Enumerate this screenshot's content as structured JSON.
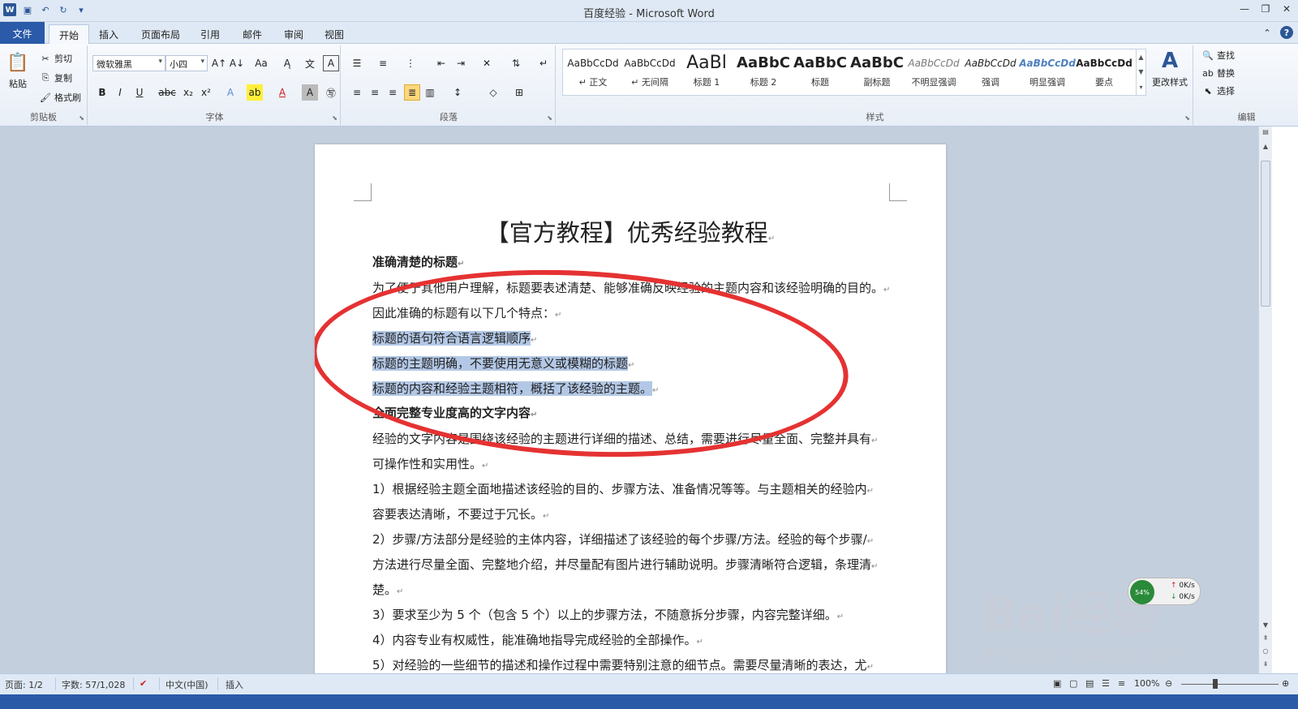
{
  "window": {
    "title": "百度经验 - Microsoft Word"
  },
  "qat": {
    "app_icon": "W"
  },
  "tabs": [
    "文件",
    "开始",
    "插入",
    "页面布局",
    "引用",
    "邮件",
    "审阅",
    "视图"
  ],
  "ribbon": {
    "clipboard": {
      "label": "剪贴板",
      "paste": "粘贴",
      "cut": "剪切",
      "copy": "复制",
      "format_painter": "格式刷"
    },
    "font": {
      "label": "字体",
      "font_name": "微软雅黑",
      "font_size": "小四"
    },
    "paragraph": {
      "label": "段落"
    },
    "styles": {
      "label": "样式",
      "items": [
        {
          "sample": "AaBbCcDd",
          "name": "↵ 正文"
        },
        {
          "sample": "AaBbCcDd",
          "name": "↵ 无间隔"
        },
        {
          "sample": "AaBl",
          "name": "标题 1"
        },
        {
          "sample": "AaBbC",
          "name": "标题 2"
        },
        {
          "sample": "AaBbC",
          "name": "标题"
        },
        {
          "sample": "AaBbC",
          "name": "副标题"
        },
        {
          "sample": "AaBbCcDd",
          "name": "不明显强调"
        },
        {
          "sample": "AaBbCcDd",
          "name": "强调"
        },
        {
          "sample": "AaBbCcDd",
          "name": "明显强调"
        },
        {
          "sample": "AaBbCcDd",
          "name": "要点"
        }
      ],
      "change_styles": "更改样式"
    },
    "editing": {
      "label": "编辑",
      "find": "查找",
      "replace": "替换",
      "select": "选择"
    }
  },
  "document": {
    "title": "【官方教程】优秀经验教程",
    "lines": [
      {
        "text": "准确清楚的标题",
        "bold": true
      },
      {
        "text": "为了便于其他用户理解，标题要表述清楚、能够准确反映经验的主题内容和该经验明确的目的。"
      },
      {
        "text": "因此准确的标题有以下几个特点："
      },
      {
        "text": "标题的语句符合语言逻辑顺序",
        "selected": true
      },
      {
        "text": "标题的主题明确，不要使用无意义或模糊的标题",
        "selected": true
      },
      {
        "text": "标题的内容和经验主题相符，概括了该经验的主题。",
        "selected": true
      },
      {
        "text": "全面完整专业度高的文字内容",
        "bold": true
      },
      {
        "text": "经验的文字内容是围绕该经验的主题进行详细的描述、总结，需要进行尽量全面、完整并具有"
      },
      {
        "text": "可操作性和实用性。"
      },
      {
        "text": "1）根据经验主题全面地描述该经验的目的、步骤方法、准备情况等等。与主题相关的经验内"
      },
      {
        "text": "容要表达清晰，不要过于冗长。"
      },
      {
        "text": "2）步骤/方法部分是经验的主体内容，详细描述了该经验的每个步骤/方法。经验的每个步骤/"
      },
      {
        "text": "方法进行尽量全面、完整地介绍，并尽量配有图片进行辅助说明。步骤清晰符合逻辑，条理清"
      },
      {
        "text": "楚。"
      },
      {
        "text": "3）要求至少为 5 个（包含 5 个）以上的步骤方法，不随意拆分步骤，内容完整详细。"
      },
      {
        "text": "4）内容专业有权威性，能准确地指导完成经验的全部操作。"
      },
      {
        "text": "5）对经验的一些细节的描述和操作过程中需要特别注意的细节点。需要尽量清晰的表达，尤"
      }
    ]
  },
  "status": {
    "page": "页面: 1/2",
    "words": "字数: 57/1,028",
    "language": "中文(中国)",
    "mode": "插入",
    "zoom": "100%"
  },
  "watermark": {
    "logo": "Bai经验",
    "sub": "jingyan.baidu.com"
  },
  "netmon": {
    "up": "0K/s",
    "down": "0K/s",
    "percent": "54%"
  },
  "colors": {
    "accent": "#2a5aa8",
    "selection": "#b3c8e6",
    "ellipse": "#e53232"
  }
}
